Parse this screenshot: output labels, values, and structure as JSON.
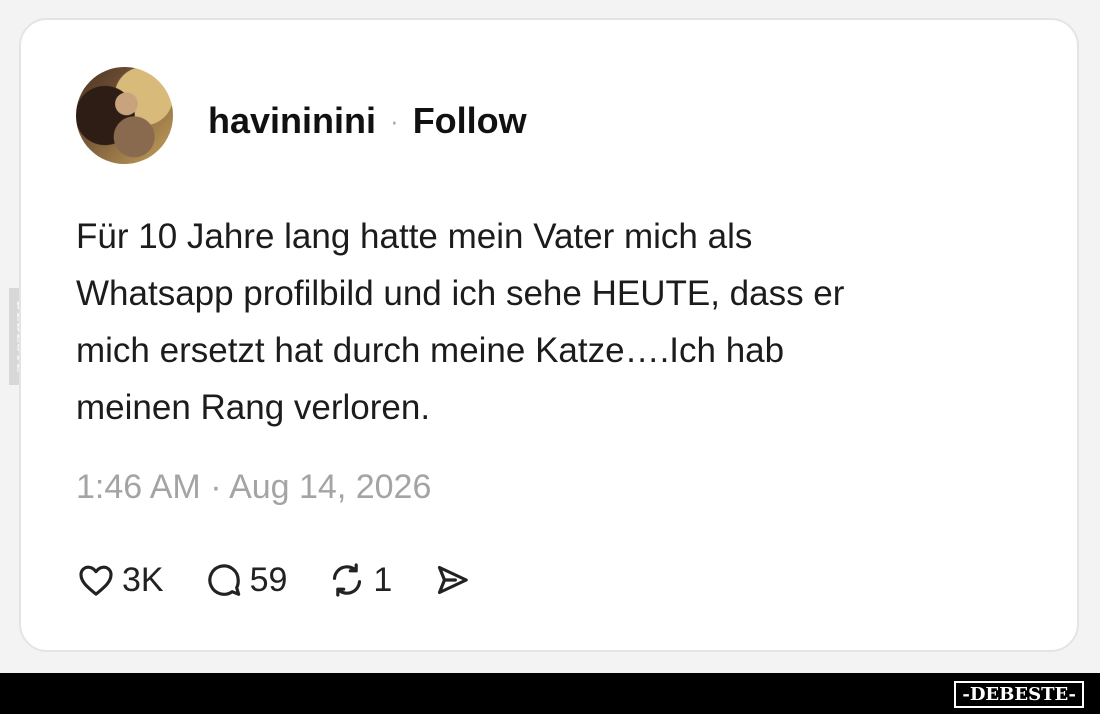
{
  "post": {
    "username": "havininini",
    "separator": "·",
    "follow_label": "Follow",
    "text_lines": [
      "Für 10 Jahre lang hatte mein Vater mich als",
      "Whatsapp profilbild und ich sehe HEUTE, dass er",
      "mich ersetzt hat durch meine Katze….Ich hab",
      "meinen Rang verloren."
    ],
    "timestamp": "1:46 AM · Aug 14, 2026"
  },
  "actions": {
    "likes": "3K",
    "replies": "59",
    "reposts": "1",
    "icons": [
      "heart-icon",
      "comment-icon",
      "repost-icon",
      "share-icon"
    ]
  },
  "watermark": {
    "side_text": "DEBESTE",
    "logo_text": "-DEBESTE-"
  },
  "colors": {
    "background": "#f3f3f3",
    "card": "#ffffff",
    "text": "#1c1c1c",
    "muted": "#a4a4a4",
    "bar": "#000000"
  }
}
